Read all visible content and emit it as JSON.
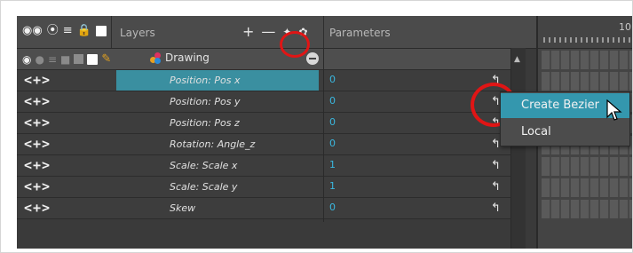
{
  "header": {
    "layers_label": "Layers",
    "parameters_label": "Parameters",
    "timeline_frame": "10"
  },
  "drawing_layer": {
    "name": "Drawing"
  },
  "rows": [
    {
      "arrows": "<+>",
      "name": "Position: Pos x",
      "value": "0",
      "selected": true
    },
    {
      "arrows": "<+>",
      "name": "Position: Pos y",
      "value": "0",
      "selected": false
    },
    {
      "arrows": "<+>",
      "name": "Position: Pos z",
      "value": "0",
      "selected": false
    },
    {
      "arrows": "<+>",
      "name": "Rotation: Angle_z",
      "value": "0",
      "selected": false
    },
    {
      "arrows": "<+>",
      "name": "Scale: Scale x",
      "value": "1",
      "selected": false
    },
    {
      "arrows": "<+>",
      "name": "Scale: Scale y",
      "value": "1",
      "selected": false
    },
    {
      "arrows": "<+>",
      "name": "Skew",
      "value": "0",
      "selected": false
    }
  ],
  "context_menu": {
    "items": [
      "Create Bezier",
      "Local"
    ]
  },
  "colors": {
    "selection": "#3a8fa0",
    "menu_highlight": "#3497ae",
    "value_text": "#3ab8e0",
    "annotation_red": "#e01515"
  },
  "icons": [
    "onion-skin-icon",
    "visibility-icon",
    "stack-icon",
    "lock-icon",
    "color-swatch-icon",
    "add-layer-icon",
    "remove-layer-icon",
    "add-peg-icon",
    "add-drawing-icon",
    "collapse-icon",
    "function-curve-icon",
    "pencil-icon",
    "mouse-cursor-icon"
  ]
}
